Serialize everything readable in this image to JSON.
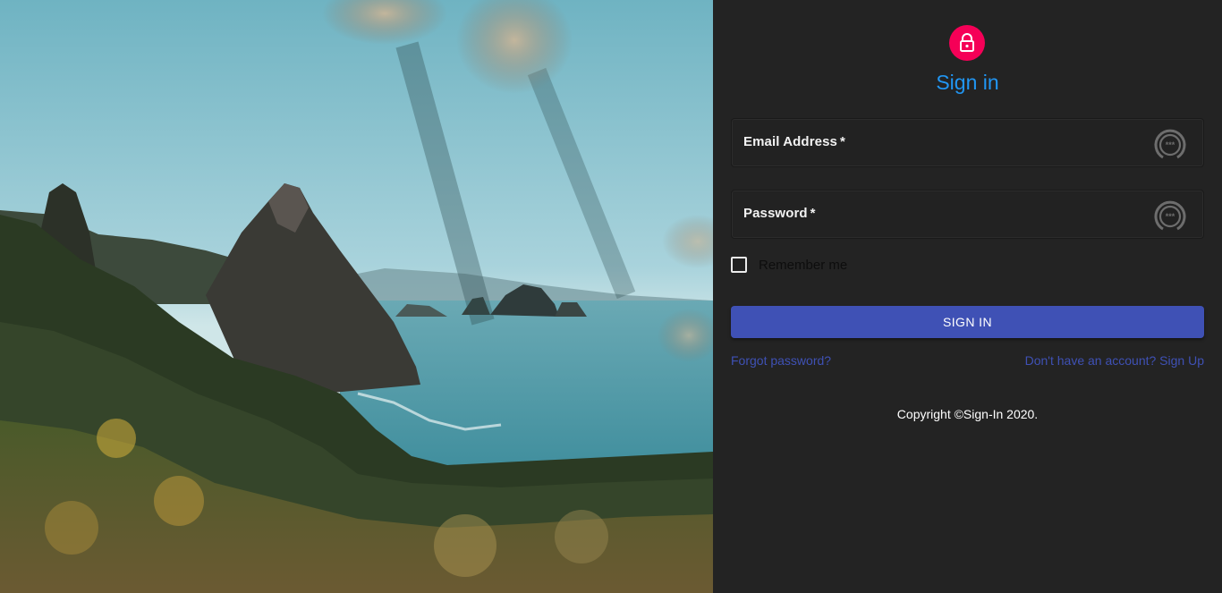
{
  "hero": {
    "image_description_icon": "coastal-landscape-image"
  },
  "form": {
    "title": "Sign in",
    "avatar_icon": "lock-icon",
    "email": {
      "label": "Email Address",
      "required_mark": "*",
      "value": ""
    },
    "password": {
      "label": "Password",
      "required_mark": "*",
      "value": ""
    },
    "password_manager_icon": "password-manager-icon",
    "remember_me": {
      "label": "Remember me",
      "checked": false
    },
    "submit_label": "SIGN IN",
    "forgot_password_link": "Forgot password?",
    "signup_link": "Don't have an account? Sign Up"
  },
  "footer": {
    "copyright": "Copyright ©Sign-In 2020."
  },
  "colors": {
    "panel_background": "#232323",
    "avatar": "#f50057",
    "title": "#2196f3",
    "primary_button": "#3f51b5",
    "link": "#3f51b5"
  }
}
